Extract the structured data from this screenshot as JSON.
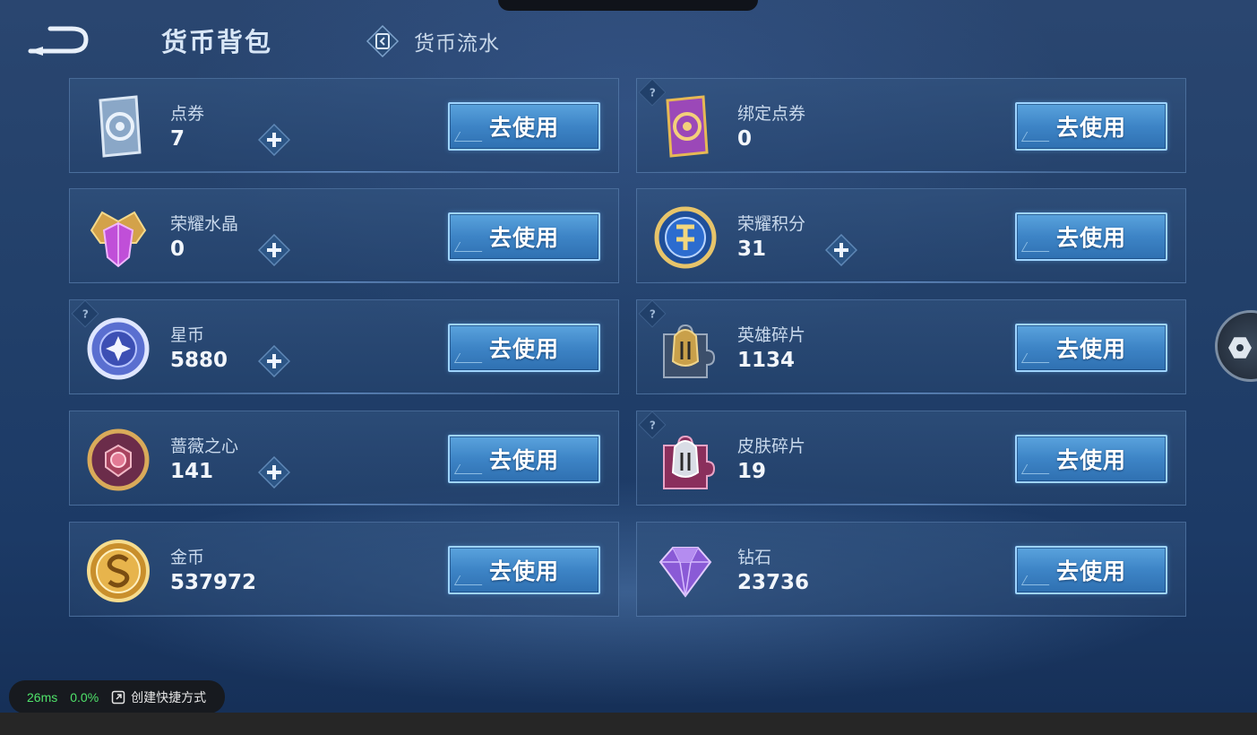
{
  "header": {
    "title": "货币背包",
    "tab_flow": "货币流水",
    "back_icon": "back-arrow-icon",
    "flow_icon": "ledger-icon"
  },
  "use_label": "去使用",
  "currencies": [
    {
      "name": "点券",
      "value": "7",
      "icon": "voucher-card-icon",
      "has_plus": true,
      "has_help": false
    },
    {
      "name": "绑定点券",
      "value": "0",
      "icon": "bound-voucher-card-icon",
      "has_plus": false,
      "has_help": true
    },
    {
      "name": "荣耀水晶",
      "value": "0",
      "icon": "glory-crystal-icon",
      "has_plus": true,
      "has_help": false
    },
    {
      "name": "荣耀积分",
      "value": "31",
      "icon": "glory-points-icon",
      "has_plus": true,
      "has_help": false
    },
    {
      "name": "星币",
      "value": "5880",
      "icon": "star-coin-icon",
      "has_plus": true,
      "has_help": true
    },
    {
      "name": "英雄碎片",
      "value": "1134",
      "icon": "hero-fragment-icon",
      "has_plus": false,
      "has_help": true
    },
    {
      "name": "蔷薇之心",
      "value": "141",
      "icon": "rose-heart-icon",
      "has_plus": true,
      "has_help": false
    },
    {
      "name": "皮肤碎片",
      "value": "19",
      "icon": "skin-fragment-icon",
      "has_plus": false,
      "has_help": true
    },
    {
      "name": "金币",
      "value": "537972",
      "icon": "gold-coin-icon",
      "has_plus": false,
      "has_help": false
    },
    {
      "name": "钻石",
      "value": "23736",
      "icon": "diamond-icon",
      "has_plus": false,
      "has_help": false
    }
  ],
  "status": {
    "ping": "26ms",
    "loss": "0.0%",
    "shortcut_label": "创建快捷方式",
    "shortcut_icon": "shortcut-icon"
  },
  "colors": {
    "background": "#22406a",
    "button": "#3d84c6",
    "button_border": "#9ed4ff",
    "status_green": "#4fe36a"
  }
}
